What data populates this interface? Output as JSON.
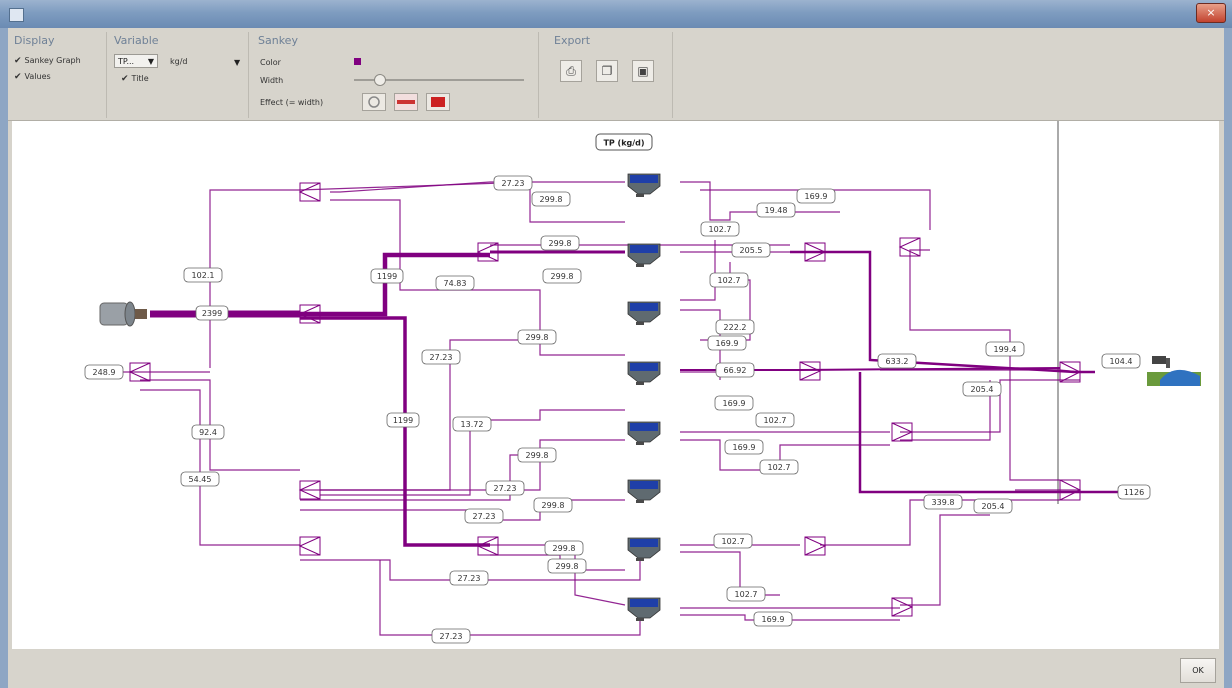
{
  "window": {
    "icon": "app-window-icon",
    "close": "×"
  },
  "toolbar": {
    "display": {
      "title": "Display",
      "items": [
        {
          "label": "Sankey Graph",
          "checked": true
        },
        {
          "label": "Values",
          "checked": true
        }
      ]
    },
    "variable": {
      "title": "Variable",
      "combo_value": "TP...",
      "unit": "kg/d",
      "title_option": "Title",
      "title_checked": true
    },
    "sankey": {
      "title": "Sankey",
      "color_label": "Color",
      "color": "#800080",
      "width_label": "Width",
      "width_level": 0.15,
      "effect_label": "Effect (= width)"
    },
    "export": {
      "title": "Export",
      "buttons": [
        "print-icon",
        "copy-icon",
        "save-icon"
      ]
    }
  },
  "diagram": {
    "title": "TP (kg/d)",
    "flow_color": "#800080",
    "labels": [
      "27.23",
      "299.8",
      "169.9",
      "19.48",
      "102.7",
      "299.8",
      "205.5",
      "102.1",
      "1199",
      "74.83",
      "299.8",
      "102.7",
      "2399",
      "222.2",
      "27.23",
      "299.8",
      "169.9",
      "633.2",
      "199.4",
      "104.4",
      "248.9",
      "66.92",
      "205.4",
      "1199",
      "169.9",
      "102.7",
      "13.72",
      "92.4",
      "169.9",
      "299.8",
      "102.7",
      "54.45",
      "27.23",
      "299.8",
      "27.23",
      "339.8",
      "205.4",
      "1126",
      "299.8",
      "102.7",
      "299.8",
      "27.23",
      "102.7",
      "169.9",
      "27.23"
    ]
  },
  "dialog": {
    "ok_label": "OK"
  }
}
